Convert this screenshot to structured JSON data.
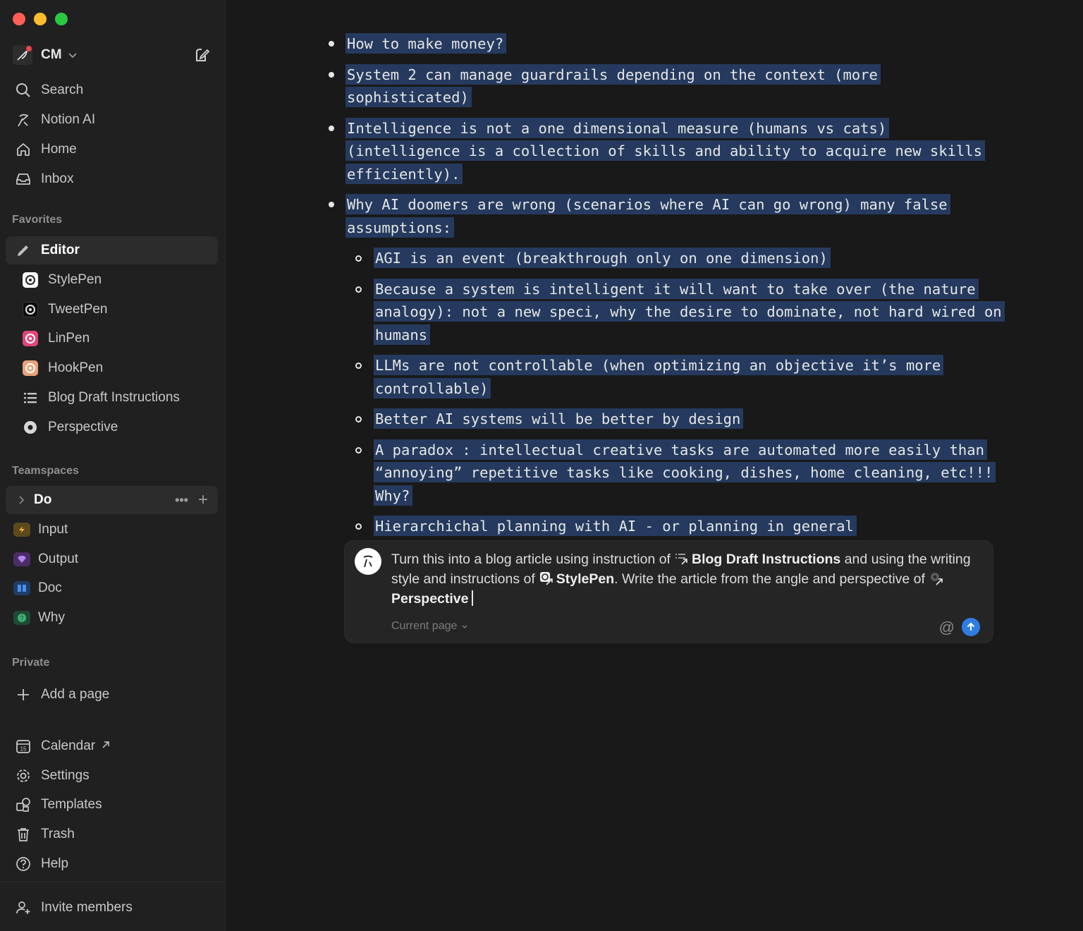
{
  "workspace": {
    "name": "CM"
  },
  "nav": {
    "search": "Search",
    "notion_ai": "Notion AI",
    "home": "Home",
    "inbox": "Inbox"
  },
  "favorites": {
    "label": "Favorites",
    "items": [
      {
        "label": "Editor"
      },
      {
        "label": "StylePen"
      },
      {
        "label": "TweetPen"
      },
      {
        "label": "LinPen"
      },
      {
        "label": "HookPen"
      },
      {
        "label": "Blog Draft Instructions"
      },
      {
        "label": "Perspective"
      }
    ]
  },
  "teamspaces": {
    "label": "Teamspaces",
    "items": [
      {
        "label": "Do"
      },
      {
        "label": "Input"
      },
      {
        "label": "Output"
      },
      {
        "label": "Doc"
      },
      {
        "label": "Why"
      }
    ]
  },
  "private": {
    "label": "Private",
    "add_page": "Add a page"
  },
  "bottom_nav": {
    "calendar": "Calendar",
    "settings": "Settings",
    "templates": "Templates",
    "trash": "Trash",
    "help": "Help",
    "invite": "Invite members"
  },
  "content": {
    "bullets": [
      {
        "level": 1,
        "text": "How to make money?"
      },
      {
        "level": 1,
        "text": "System 2 can manage guardrails depending on the context (more sophisticated)"
      },
      {
        "level": 1,
        "text": "Intelligence is not a one dimensional measure (humans vs cats) (intelligence is a collection of skills and ability to acquire new skills efficiently)."
      },
      {
        "level": 1,
        "text": "Why AI doomers are wrong (scenarios where AI can go wrong) many false assumptions:"
      },
      {
        "level": 2,
        "text": "AGI is an event (breakthrough only on one dimension)"
      },
      {
        "level": 2,
        "text": "Because a system is intelligent it will want to take over (the nature analogy): not a new speci, why the desire to dominate, not hard wired on humans"
      },
      {
        "level": 2,
        "text": "LLMs are not controllable (when optimizing an objective it’s more controllable)"
      },
      {
        "level": 2,
        "text": "Better AI systems will be better by design"
      },
      {
        "level": 2,
        "text": "A paradox : intellectual creative tasks are automated more easily than “annoying” repetitive tasks like cooking, dishes, home cleaning, etc!!! Why?"
      },
      {
        "level": 2,
        "text": "Hierarchichal planning with AI - or planning in general"
      }
    ]
  },
  "prompt": {
    "part1": "Turn this into a blog article using instruction of",
    "ref1": "Blog Draft Instructions",
    "part2": "and using the writing style and instructions of",
    "ref2": "StylePen",
    "part3": ". Write the article from the angle and perspective of",
    "ref3": "Perspective",
    "scope": "Current page",
    "mention": "@"
  },
  "colors": {
    "highlight": "#253a5e",
    "send": "#2f7de1",
    "background": "#191919",
    "sidebar": "#202020"
  }
}
